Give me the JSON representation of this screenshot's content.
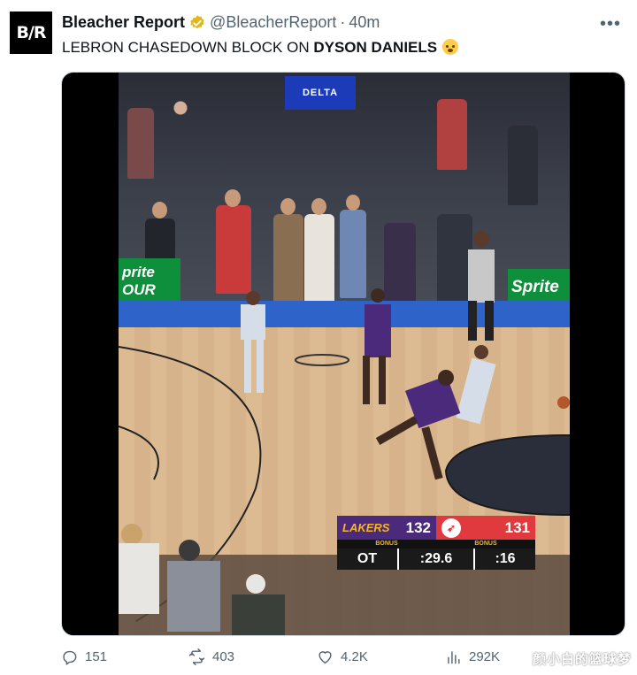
{
  "author": {
    "avatar_text": "B/R",
    "name": "Bleacher Report",
    "handle": "@BleacherReport",
    "separator": "·",
    "time": "40m"
  },
  "tweet": {
    "text_prefix": "LEBRON CHASEDOWN BLOCK ON ",
    "text_bold": "DYSON DANIELS",
    "emoji": "exploding-head-emoji"
  },
  "video": {
    "sponsor_top": "DELTA",
    "sponsor_left": "prite OUR THIRST",
    "sponsor_right": "Sprite",
    "scoreboard": {
      "home_logo": "LAKERS",
      "home_score": "132",
      "away_score": "131",
      "home_bonus": "BONUS",
      "away_bonus": "BONUS",
      "period": "OT",
      "clock": ":29.6",
      "shot_clock": ":16",
      "home_color": "#4b2a7b",
      "away_color": "#e03a3e"
    }
  },
  "actions": {
    "replies": "151",
    "reposts": "403",
    "likes": "4.2K",
    "views": "292K"
  },
  "watermark": "颜小白的篮球梦",
  "colors": {
    "secondary_text": "#536471",
    "verified_gold": "#e2b719"
  }
}
